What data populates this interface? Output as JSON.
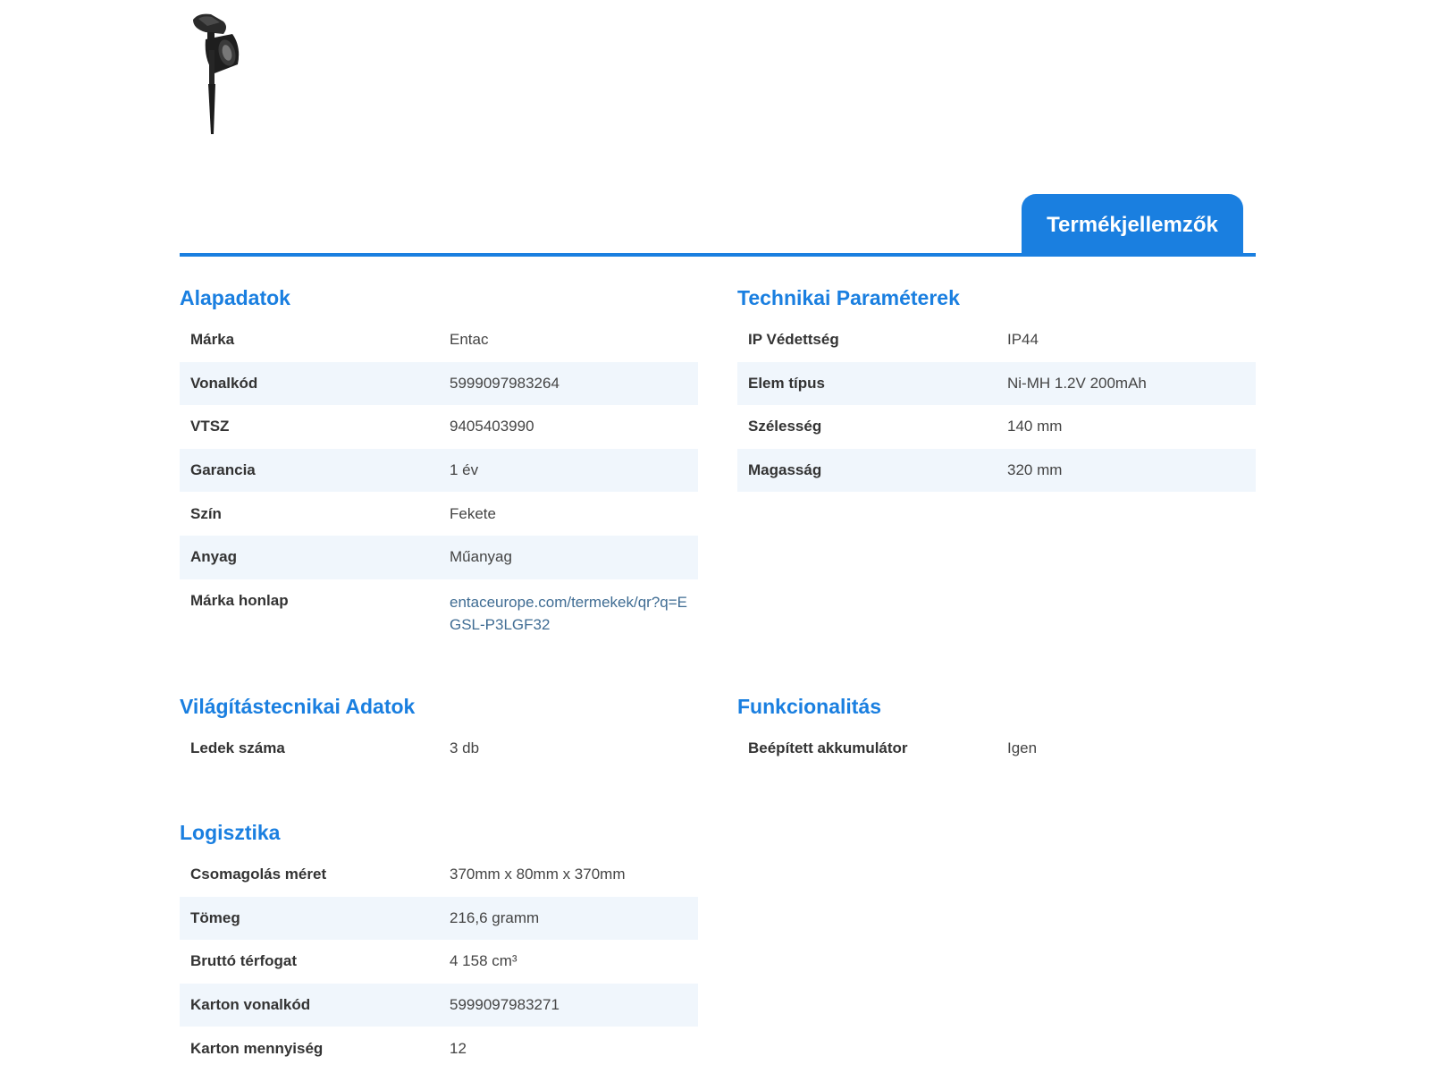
{
  "product_image": {
    "icon": "solar-spot-lamp-icon",
    "color": "#1e1e1e"
  },
  "tabs": [
    {
      "label": "Termékjellemzők",
      "active": true
    }
  ],
  "colors": {
    "accent": "#1a7fe0",
    "row_alt": "#f0f6fc",
    "link": "#3f6c93"
  },
  "sections": {
    "alapadatok": {
      "title": "Alapadatok",
      "rows": [
        {
          "key": "Márka",
          "value": "Entac"
        },
        {
          "key": "Vonalkód",
          "value": "5999097983264"
        },
        {
          "key": "VTSZ",
          "value": "9405403990"
        },
        {
          "key": "Garancia",
          "value": "1 év"
        },
        {
          "key": "Szín",
          "value": "Fekete"
        },
        {
          "key": "Anyag",
          "value": "Műanyag"
        },
        {
          "key": "Márka honlap",
          "value": "entaceurope.com/termekek/qr?q=EGSL-P3LGF32"
        }
      ]
    },
    "technikai": {
      "title": "Technikai Paraméterek",
      "rows": [
        {
          "key": "IP Védettség",
          "value": "IP44"
        },
        {
          "key": "Elem típus",
          "value": "Ni-MH 1.2V 200mAh"
        },
        {
          "key": "Szélesség",
          "value": "140 mm"
        },
        {
          "key": "Magasság",
          "value": "320 mm"
        }
      ]
    },
    "vilagitas": {
      "title": "Világítástecnikai Adatok",
      "rows": [
        {
          "key": "Ledek száma",
          "value": "3 db"
        }
      ]
    },
    "funkcionalitas": {
      "title": "Funkcionalitás",
      "rows": [
        {
          "key": "Beépített akkumulátor",
          "value": "Igen"
        }
      ]
    },
    "logisztika": {
      "title": "Logisztika",
      "rows": [
        {
          "key": "Csomagolás méret",
          "value": "370mm x 80mm x 370mm"
        },
        {
          "key": "Tömeg",
          "value": "216,6 gramm"
        },
        {
          "key": "Bruttó térfogat",
          "value": "4 158 cm³"
        },
        {
          "key": "Karton vonalkód",
          "value": "5999097983271"
        },
        {
          "key": "Karton mennyiség",
          "value": "12"
        }
      ]
    }
  }
}
